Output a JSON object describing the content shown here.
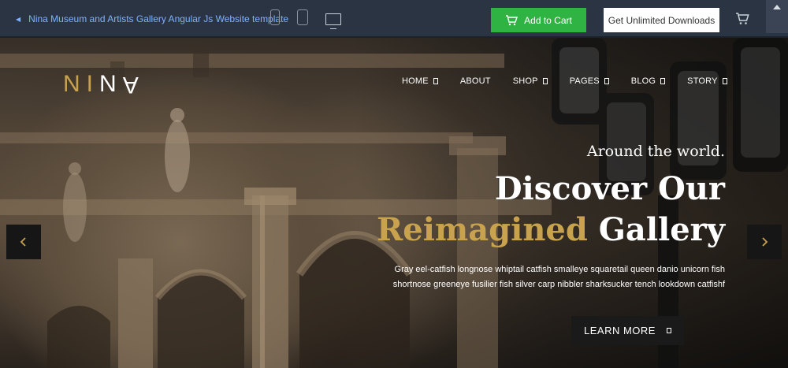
{
  "toolbar": {
    "back_link": "Nina Museum and Artists Gallery Angular Js Website template",
    "add_to_cart": "Add to Cart",
    "get_downloads": "Get Unlimited Downloads",
    "icons": [
      "phone-icon",
      "tablet-icon",
      "desktop-icon",
      "cart-icon",
      "collapse-icon"
    ]
  },
  "brand": {
    "logo_letters": [
      "N",
      "I",
      "N",
      "A"
    ]
  },
  "nav": {
    "items": [
      {
        "label": "HOME"
      },
      {
        "label": "ABOUT"
      },
      {
        "label": "SHOP"
      },
      {
        "label": "PAGES"
      },
      {
        "label": "BLOG"
      },
      {
        "label": "STORY"
      }
    ]
  },
  "hero": {
    "subtitle": "Around the world.",
    "headline_line1": "Discover Our",
    "headline_gold": "Reimagined",
    "headline_white": "Gallery",
    "description_line1": "Gray eel-catfish longnose whiptail catfish smalleye squaretail queen danio unicorn fish",
    "description_line2": "shortnose greeneye fusilier fish silver carp nibbler sharksucker tench lookdown catfishf",
    "cta": "LEARN MORE"
  },
  "colors": {
    "accent_gold": "#c9a24d",
    "cart_green": "#2fb443",
    "toolbar_bg": "#2b3442",
    "link_blue": "#7fb2ff"
  }
}
